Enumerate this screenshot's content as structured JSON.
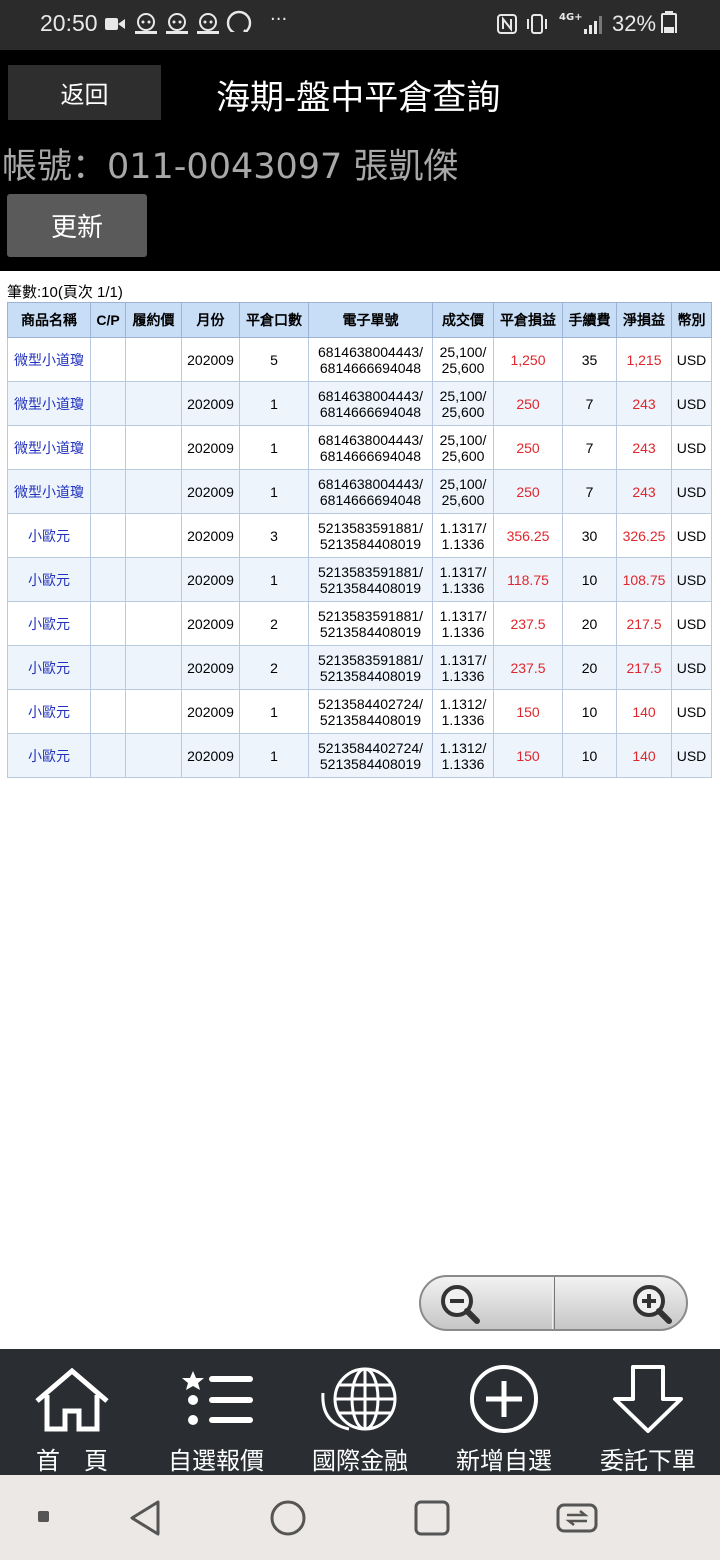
{
  "status_bar": {
    "time": "20:50",
    "more": "···",
    "network": "4G+",
    "battery": "32%",
    "icons": [
      "video-icon",
      "gomaji-icon",
      "gomaji-icon",
      "gomaji-icon",
      "chat-icon",
      "nfc-icon",
      "vibrate-icon",
      "signal-icon",
      "battery-icon"
    ]
  },
  "header": {
    "back_label": "返回",
    "title": "海期-盤中平倉查詢",
    "account": "帳號：011-0043097 張凱傑",
    "refresh_label": "更新"
  },
  "count_text": "筆數:10(頁次 1/1)",
  "table": {
    "columns": [
      "商品名稱",
      "C/P",
      "履約價",
      "月份",
      "平倉口數",
      "電子單號",
      "成交價",
      "平倉損益",
      "手續費",
      "淨損益",
      "幣別"
    ],
    "rows": [
      {
        "product": "微型小道瓊",
        "cp": "",
        "strike": "",
        "month": "202009",
        "qty": "5",
        "order_1": "6814638004443/",
        "order_2": "6814666694048",
        "price_1": "25,100/",
        "price_2": "25,600",
        "pnl": "1,250",
        "fee": "35",
        "net": "1,215",
        "currency": "USD"
      },
      {
        "product": "微型小道瓊",
        "cp": "",
        "strike": "",
        "month": "202009",
        "qty": "1",
        "order_1": "6814638004443/",
        "order_2": "6814666694048",
        "price_1": "25,100/",
        "price_2": "25,600",
        "pnl": "250",
        "fee": "7",
        "net": "243",
        "currency": "USD"
      },
      {
        "product": "微型小道瓊",
        "cp": "",
        "strike": "",
        "month": "202009",
        "qty": "1",
        "order_1": "6814638004443/",
        "order_2": "6814666694048",
        "price_1": "25,100/",
        "price_2": "25,600",
        "pnl": "250",
        "fee": "7",
        "net": "243",
        "currency": "USD"
      },
      {
        "product": "微型小道瓊",
        "cp": "",
        "strike": "",
        "month": "202009",
        "qty": "1",
        "order_1": "6814638004443/",
        "order_2": "6814666694048",
        "price_1": "25,100/",
        "price_2": "25,600",
        "pnl": "250",
        "fee": "7",
        "net": "243",
        "currency": "USD"
      },
      {
        "product": "小歐元",
        "cp": "",
        "strike": "",
        "month": "202009",
        "qty": "3",
        "order_1": "5213583591881/",
        "order_2": "5213584408019",
        "price_1": "1.1317/",
        "price_2": "1.1336",
        "pnl": "356.25",
        "fee": "30",
        "net": "326.25",
        "currency": "USD"
      },
      {
        "product": "小歐元",
        "cp": "",
        "strike": "",
        "month": "202009",
        "qty": "1",
        "order_1": "5213583591881/",
        "order_2": "5213584408019",
        "price_1": "1.1317/",
        "price_2": "1.1336",
        "pnl": "118.75",
        "fee": "10",
        "net": "108.75",
        "currency": "USD"
      },
      {
        "product": "小歐元",
        "cp": "",
        "strike": "",
        "month": "202009",
        "qty": "2",
        "order_1": "5213583591881/",
        "order_2": "5213584408019",
        "price_1": "1.1317/",
        "price_2": "1.1336",
        "pnl": "237.5",
        "fee": "20",
        "net": "217.5",
        "currency": "USD"
      },
      {
        "product": "小歐元",
        "cp": "",
        "strike": "",
        "month": "202009",
        "qty": "2",
        "order_1": "5213583591881/",
        "order_2": "5213584408019",
        "price_1": "1.1317/",
        "price_2": "1.1336",
        "pnl": "237.5",
        "fee": "20",
        "net": "217.5",
        "currency": "USD"
      },
      {
        "product": "小歐元",
        "cp": "",
        "strike": "",
        "month": "202009",
        "qty": "1",
        "order_1": "5213584402724/",
        "order_2": "5213584408019",
        "price_1": "1.1312/",
        "price_2": "1.1336",
        "pnl": "150",
        "fee": "10",
        "net": "140",
        "currency": "USD"
      },
      {
        "product": "小歐元",
        "cp": "",
        "strike": "",
        "month": "202009",
        "qty": "1",
        "order_1": "5213584402724/",
        "order_2": "5213584408019",
        "price_1": "1.1312/",
        "price_2": "1.1336",
        "pnl": "150",
        "fee": "10",
        "net": "140",
        "currency": "USD"
      }
    ]
  },
  "zoom": {
    "out_icon": "zoom-out-icon",
    "in_icon": "zoom-in-icon"
  },
  "bottom_nav": [
    {
      "label": "首　頁",
      "icon": "home-icon"
    },
    {
      "label": "自選報價",
      "icon": "list-icon"
    },
    {
      "label": "國際金融",
      "icon": "globe-icon"
    },
    {
      "label": "新增自選",
      "icon": "plus-circle-icon"
    },
    {
      "label": "委託下單",
      "icon": "download-arrow-icon"
    }
  ],
  "system_nav": [
    "recent-dot-icon",
    "back-triangle-icon",
    "home-circle-icon",
    "overview-square-icon",
    "switch-app-icon"
  ],
  "colors": {
    "header_bg": "#000000",
    "table_header_bg": "#c8ddf6",
    "row_alt_bg": "#eef4fc",
    "product_text": "#2233bb",
    "pnl_text": "#e0262c",
    "bottom_nav_bg": "#2a2e33"
  }
}
